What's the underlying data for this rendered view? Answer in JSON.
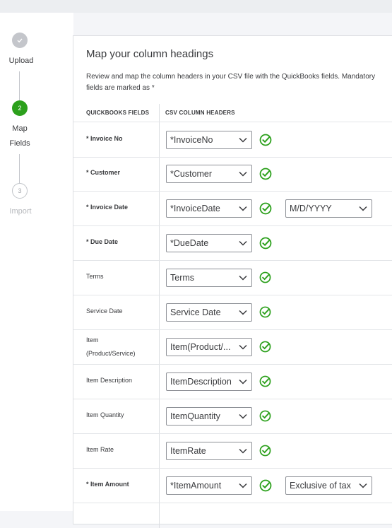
{
  "stepper": {
    "steps": [
      {
        "number": "✓",
        "label_line1": "Upload",
        "label_line2": ""
      },
      {
        "number": "2",
        "label_line1": "Map",
        "label_line2": "Fields"
      },
      {
        "number": "3",
        "label_line1": "Import",
        "label_line2": ""
      }
    ]
  },
  "panel": {
    "title": "Map your column headings",
    "description": "Review and map the column headers in your CSV file with the QuickBooks fields. Mandatory fields are marked as *",
    "col_quickbooks": "QUICKBOOKS FIELDS",
    "col_csv": "CSV COLUMN HEADERS"
  },
  "fields": [
    {
      "label": "* Invoice No",
      "required": true,
      "mapped": "*InvoiceNo",
      "extra": ""
    },
    {
      "label": "* Customer",
      "required": true,
      "mapped": "*Customer",
      "extra": ""
    },
    {
      "label": "* Invoice Date",
      "required": true,
      "mapped": "*InvoiceDate",
      "extra": "M/D/YYYY"
    },
    {
      "label": "* Due Date",
      "required": true,
      "mapped": "*DueDate",
      "extra": ""
    },
    {
      "label": "Terms",
      "required": false,
      "mapped": "Terms",
      "extra": ""
    },
    {
      "label": "Service Date",
      "required": false,
      "mapped": "Service Date",
      "extra": ""
    },
    {
      "label": "Item\n(Product/Service)",
      "label_line1": "Item",
      "label_line2": "(Product/Service)",
      "required": false,
      "mapped": "Item(Product/...",
      "extra": ""
    },
    {
      "label": "Item Description",
      "required": false,
      "mapped": "ItemDescription",
      "extra": ""
    },
    {
      "label": "Item Quantity",
      "required": false,
      "mapped": "ItemQuantity",
      "extra": ""
    },
    {
      "label": "Item Rate",
      "required": false,
      "mapped": "ItemRate",
      "extra": ""
    },
    {
      "label": "* Item Amount",
      "required": true,
      "mapped": "*ItemAmount",
      "extra": "Exclusive of tax"
    }
  ],
  "colors": {
    "accent": "#2ca01c",
    "border": "#8d9096",
    "text": "#393a3d"
  }
}
